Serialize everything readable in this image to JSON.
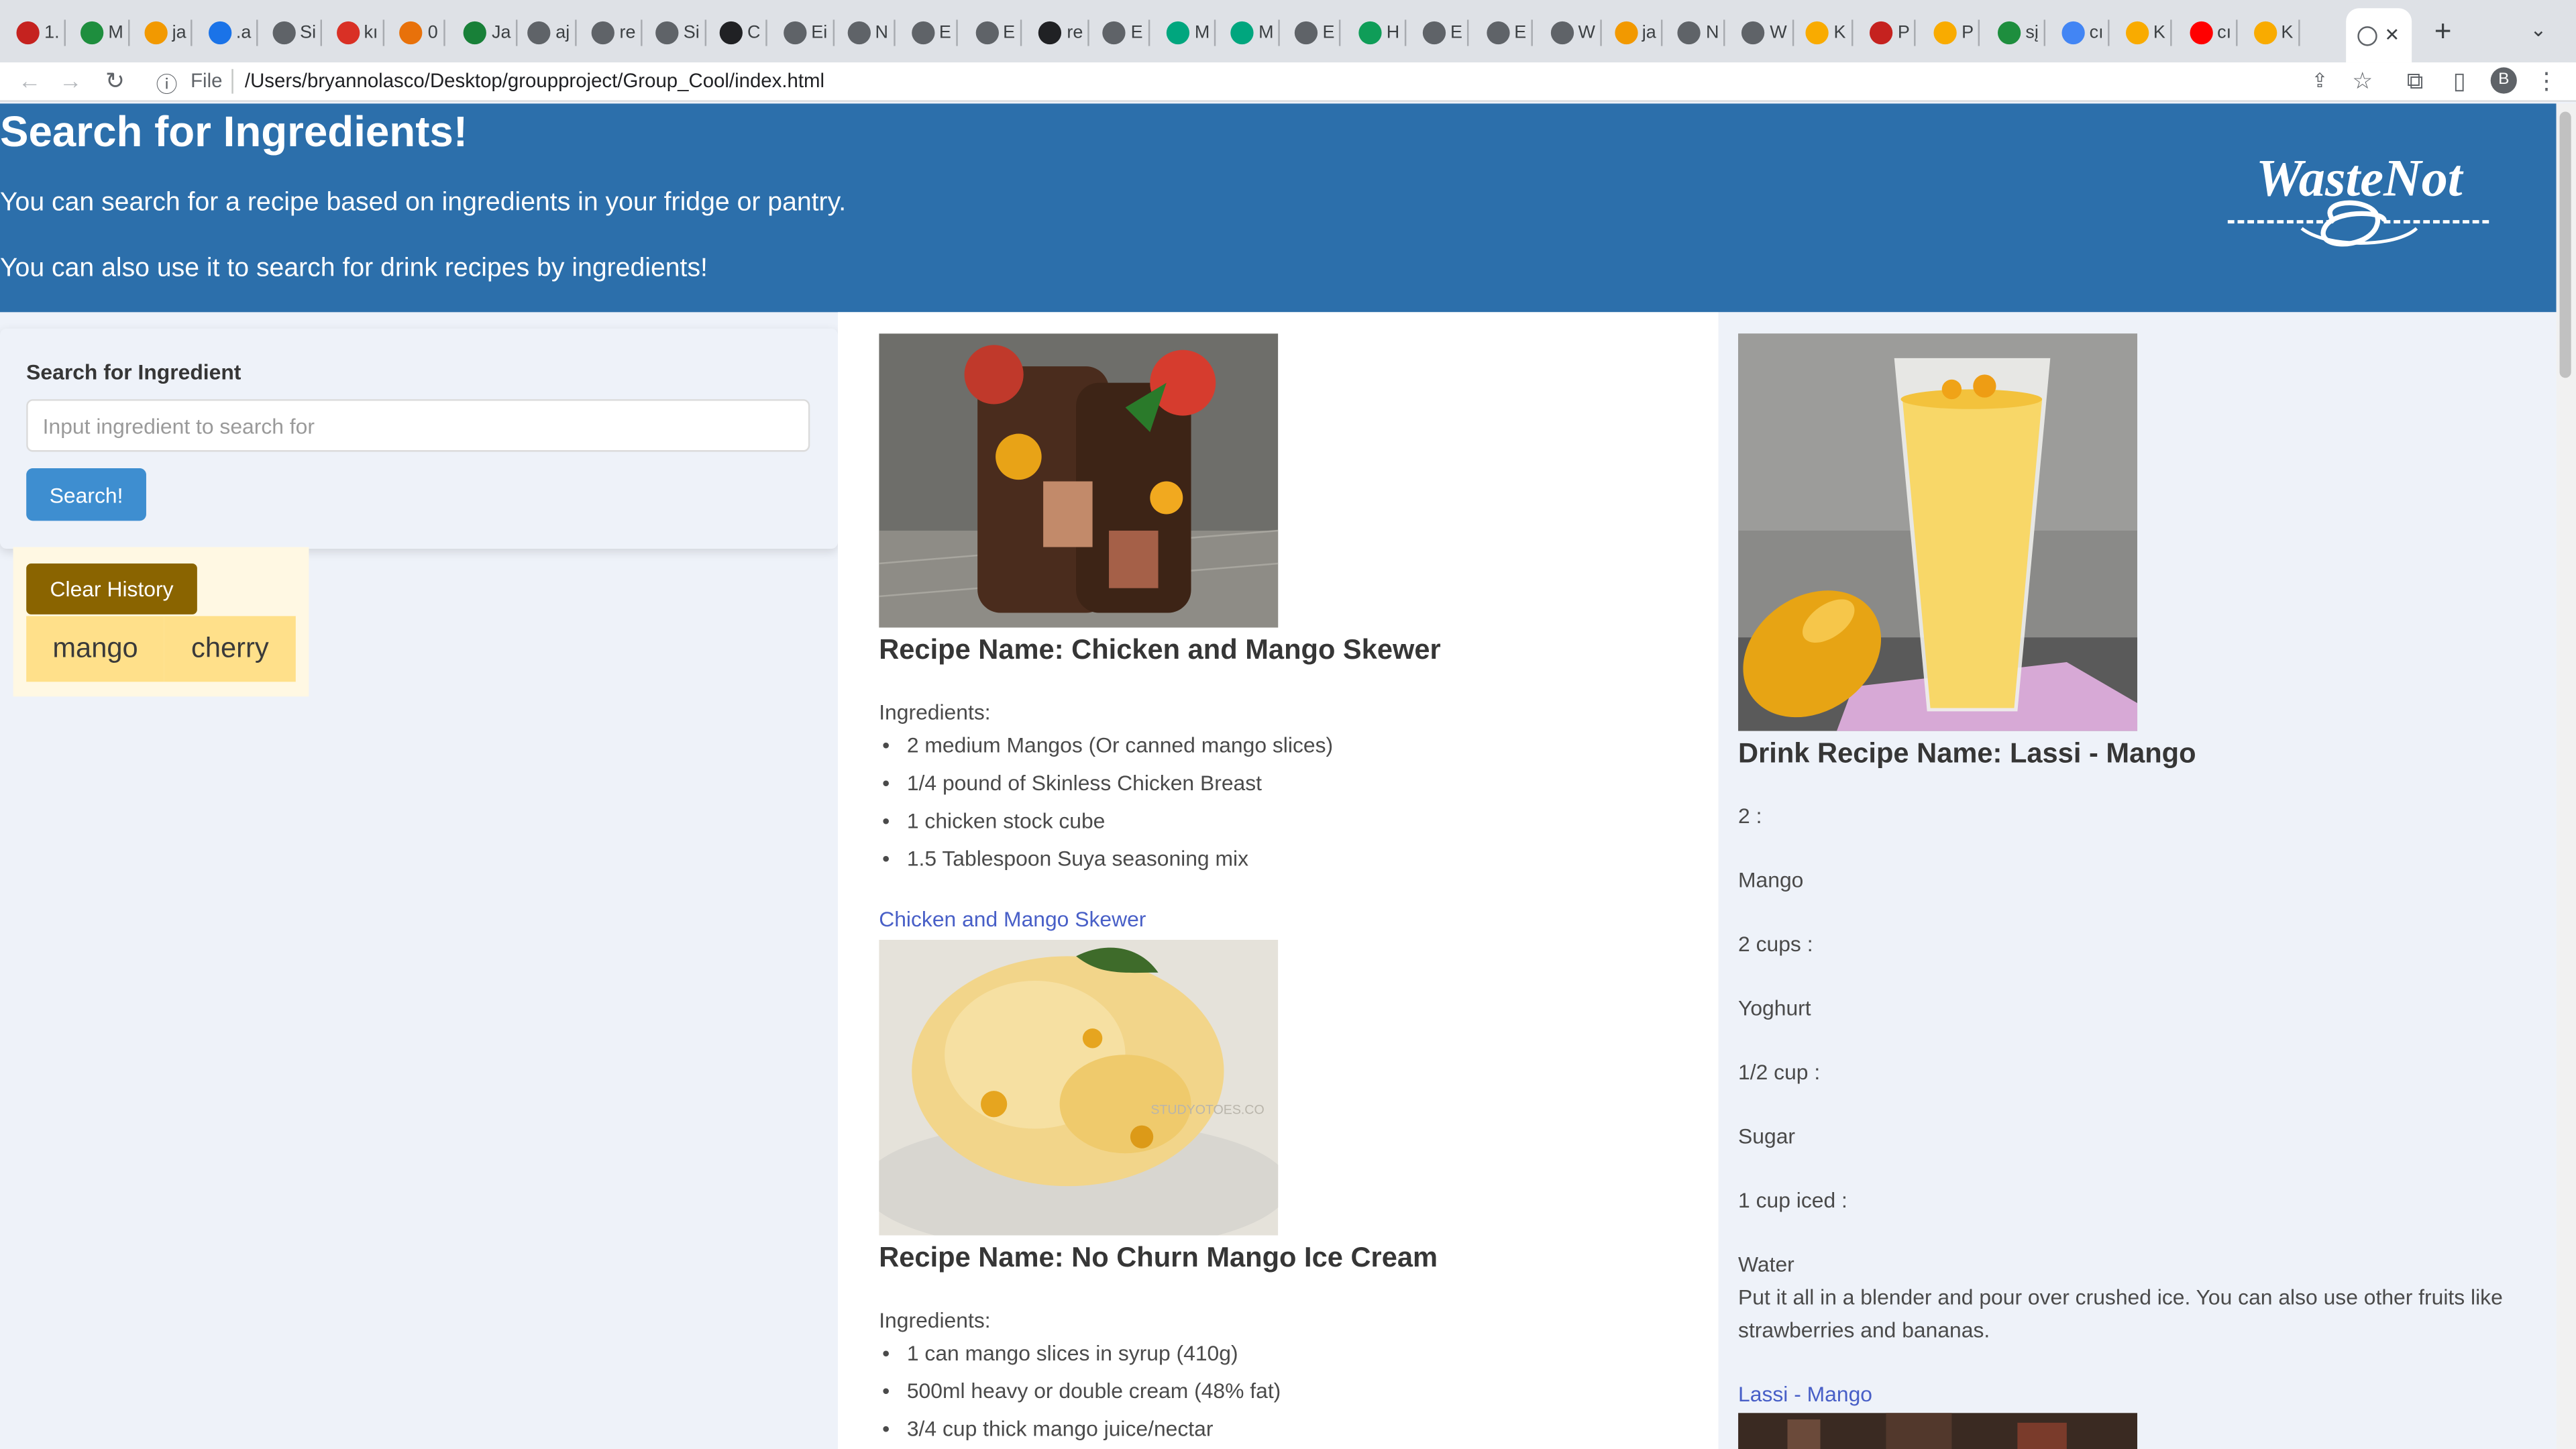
{
  "browser": {
    "tabs": [
      {
        "label": "1.",
        "color": "#c5221f"
      },
      {
        "label": "M",
        "color": "#1e8e3e"
      },
      {
        "label": "ja",
        "color": "#f29900"
      },
      {
        "label": ".a",
        "color": "#1a73e8"
      },
      {
        "label": "Si",
        "color": "#5f6368"
      },
      {
        "label": "kı",
        "color": "#d93025"
      },
      {
        "label": "0",
        "color": "#e8710a"
      },
      {
        "label": "Ja",
        "color": "#188038"
      },
      {
        "label": "aj",
        "color": "#5f6368"
      },
      {
        "label": "re",
        "color": "#5f6368"
      },
      {
        "label": "Si",
        "color": "#5f6368"
      },
      {
        "label": "C",
        "color": "#202124"
      },
      {
        "label": "Ei",
        "color": "#5f6368"
      },
      {
        "label": "N",
        "color": "#5f6368"
      },
      {
        "label": "E",
        "color": "#5f6368"
      },
      {
        "label": "E",
        "color": "#5f6368"
      },
      {
        "label": "re",
        "color": "#202124"
      },
      {
        "label": "E",
        "color": "#5f6368"
      },
      {
        "label": "M",
        "color": "#00a67e"
      },
      {
        "label": "M",
        "color": "#00a67e"
      },
      {
        "label": "E",
        "color": "#5f6368"
      },
      {
        "label": "H",
        "color": "#0f9d58"
      },
      {
        "label": "E",
        "color": "#5f6368"
      },
      {
        "label": "E",
        "color": "#5f6368"
      },
      {
        "label": "W",
        "color": "#5f6368"
      },
      {
        "label": "ja",
        "color": "#f29900"
      },
      {
        "label": "N",
        "color": "#5f6368"
      },
      {
        "label": "W",
        "color": "#5f6368"
      },
      {
        "label": "K",
        "color": "#f9ab00"
      },
      {
        "label": "P",
        "color": "#c5221f"
      },
      {
        "label": "P",
        "color": "#f9ab00"
      },
      {
        "label": "sį",
        "color": "#1e8e3e"
      },
      {
        "label": "cı",
        "color": "#4285f4"
      },
      {
        "label": "K",
        "color": "#f9ab00"
      },
      {
        "label": "cı",
        "color": "#ff0000"
      },
      {
        "label": "K",
        "color": "#f9ab00"
      }
    ],
    "active_tab_close": "✕",
    "new_tab": "+",
    "tab_search": "⌄",
    "file_label": "File",
    "url": "/Users/bryannolasco/Desktop/groupproject/Group_Cool/index.html",
    "profile_initial": "B"
  },
  "hero": {
    "title": "Search for Ingredients!",
    "line1": "You can search for a recipe based on ingredients in your fridge or pantry.",
    "line2": "You can also use it to search for drink recipes by ingredients!",
    "logo_text": "WasteNot"
  },
  "search": {
    "label": "Search for Ingredient",
    "placeholder": "Input ingredient to search for",
    "value": "",
    "button": "Search!"
  },
  "history": {
    "clear_label": "Clear History",
    "items": [
      "mango",
      "cherry"
    ]
  },
  "recipes": [
    {
      "title": "Recipe Name: Chicken and Mango Skewer",
      "ingredients_label": "Ingredients:",
      "ingredients": [
        "2 medium Mangos (Or canned mango slices)",
        "1/4 pound of Skinless Chicken Breast",
        "1 chicken stock cube",
        "1.5 Tablespoon Suya seasoning mix"
      ],
      "link": "Chicken and Mango Skewer"
    },
    {
      "title": "Recipe Name: No Churn Mango Ice Cream",
      "ingredients_label": "Ingredients:",
      "ingredients": [
        "1 can mango slices in syrup (410g)",
        "500ml heavy or double cream (48% fat)",
        "3/4 cup thick mango juice/nectar"
      ],
      "watermark": "STUDYOTOES.CO"
    }
  ],
  "drink": {
    "title": "Drink Recipe Name: Lassi - Mango",
    "lines": [
      "2 :",
      "Mango",
      "2 cups :",
      "Yoghurt",
      "1/2 cup :",
      "Sugar",
      "1 cup iced :",
      "Water"
    ],
    "instructions": "Put it all in a blender and pour over crushed ice. You can also use other fruits like strawberries and bananas.",
    "link": "Lassi - Mango"
  }
}
